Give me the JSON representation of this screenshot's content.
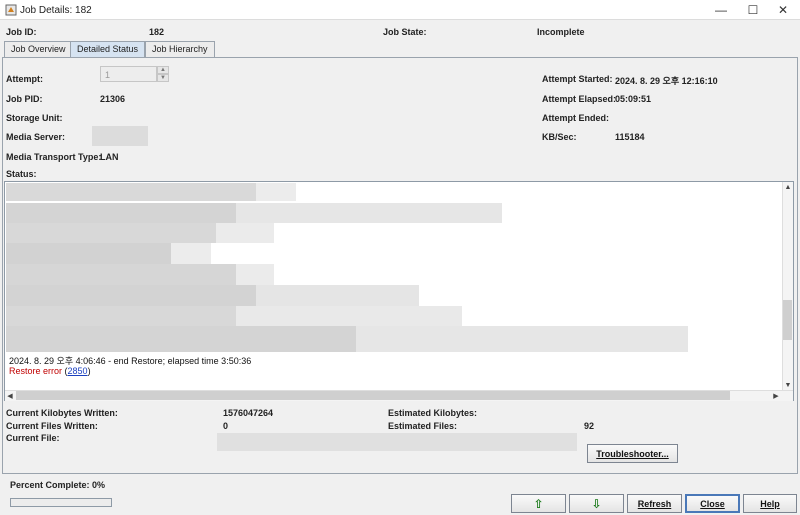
{
  "window": {
    "title": "Job Details: 182",
    "minimize_glyph": "—",
    "maximize_glyph": "☐",
    "close_glyph": "✕"
  },
  "header": {
    "job_id_label": "Job ID:",
    "job_id_value": "182",
    "job_state_label": "Job State:",
    "job_state_value": "Incomplete"
  },
  "tabs": [
    {
      "label": "Job Overview",
      "active": false
    },
    {
      "label": "Detailed Status",
      "active": true
    },
    {
      "label": "Job Hierarchy",
      "active": false
    }
  ],
  "details": {
    "attempt_label": "Attempt:",
    "attempt_value": "1",
    "job_pid_label": "Job PID:",
    "job_pid_value": "21306",
    "storage_unit_label": "Storage Unit:",
    "media_server_label": "Media Server:",
    "media_transport_label": "Media Transport Type:",
    "media_transport_value": "LAN",
    "attempt_started_label": "Attempt Started:",
    "attempt_started_value": "2024. 8. 29 오후 12:16:10",
    "attempt_elapsed_label": "Attempt Elapsed:",
    "attempt_elapsed_value": "05:09:51",
    "attempt_ended_label": "Attempt Ended:",
    "kb_sec_label": "KB/Sec:",
    "kb_sec_value": "115184"
  },
  "status": {
    "label": "Status:",
    "log_end_line": "2024. 8. 29 오후 4:06:46 - end Restore; elapsed time 3:50:36",
    "error_text": "Restore error",
    "error_open_paren": "(",
    "error_code": "2850",
    "error_close_paren": ")"
  },
  "stats": {
    "current_kb_written_label": "Current Kilobytes Written:",
    "current_kb_written_value": "1576047264",
    "current_files_written_label": "Current Files Written:",
    "current_files_written_value": "0",
    "current_file_label": "Current File:",
    "estimated_kb_label": "Estimated Kilobytes:",
    "estimated_files_label": "Estimated Files:",
    "estimated_files_value": "92"
  },
  "buttons": {
    "troubleshooter": "Troubleshooter...",
    "up_glyph": "⇧",
    "down_glyph": "⇩",
    "refresh": "Refresh",
    "close": "Close",
    "help": "Help"
  },
  "progress": {
    "label": "Percent Complete:",
    "value_text": "0%",
    "fraction": 0,
    "fill_color": "#3a7bd5"
  }
}
